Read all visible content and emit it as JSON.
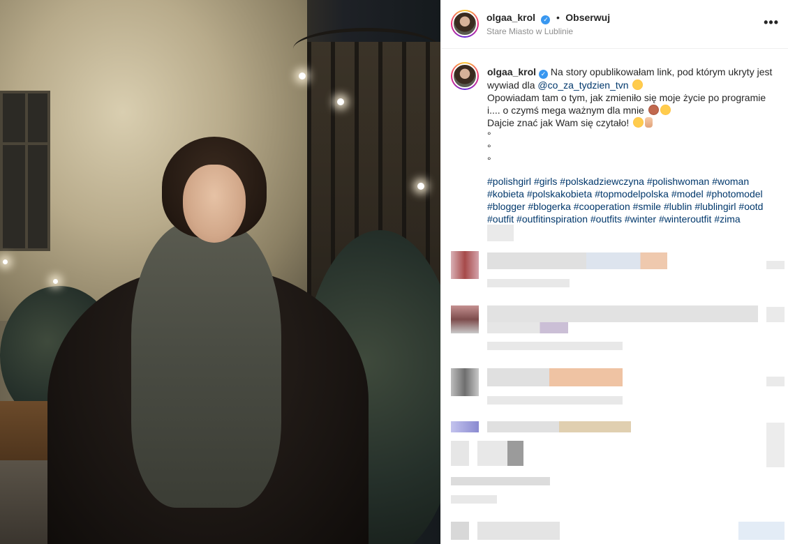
{
  "post": {
    "username": "olgaa_krol",
    "verified_mark": "✓",
    "separator": "•",
    "follow_label": "Obserwuj",
    "location": "Stare Miasto w Lublinie",
    "more_label": "•••"
  },
  "caption": {
    "username": "olgaa_krol",
    "line1": "Na story opublikowałam link, pod którym ukryty jest wywiad dla",
    "mention": "@co_za_tydzien_tvn",
    "line2": "Opowiadam tam o tym, jak zmieniło się moje życie po programie i.... o czymś mega ważnym dla mnie",
    "line3": "Dajcie znać jak Wam się czytało!",
    "dot1": "°",
    "dot2": "°",
    "dot3": "°",
    "hashtags": [
      "#polishgirl",
      "#girls",
      "#polskadziewczyna",
      "#polishwoman",
      "#woman",
      "#kobieta",
      "#polskakobieta",
      "#topmodelpolska",
      "#model",
      "#photomodel",
      "#blogger",
      "#blogerka",
      "#cooperation",
      "#smile",
      "#lublin",
      "#lublingirl",
      "#ootd",
      "#outfit",
      "#outfitinspiration",
      "#outfits",
      "#winter",
      "#winteroutfit",
      "#zima"
    ]
  },
  "icons": {
    "verified": "verified-badge-icon",
    "more": "more-options-icon",
    "emoji_star_eyes": "star-struck-emoji-icon",
    "emoji_see_no_evil": "see-no-evil-monkey-emoji-icon",
    "emoji_hushed": "hushed-face-emoji-icon",
    "emoji_wink_tongue": "winking-tongue-emoji-icon",
    "emoji_victory": "victory-hand-emoji-icon"
  },
  "colors": {
    "link": "#00376b",
    "verified": "#3897f0",
    "muted": "#8e8e8e"
  }
}
